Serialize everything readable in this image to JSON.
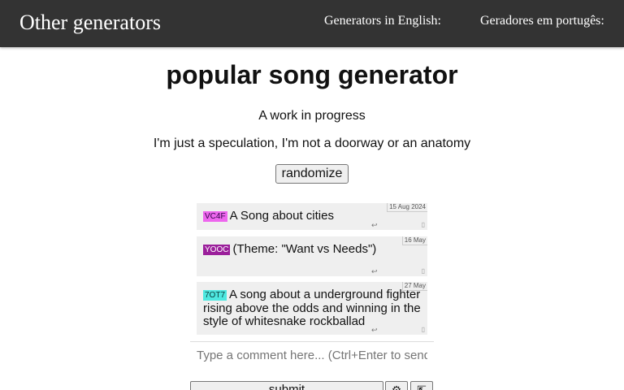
{
  "header": {
    "brand": "Other generators",
    "nav": [
      {
        "label": "Generators in English:"
      },
      {
        "label": "Geradores em portugês:"
      }
    ]
  },
  "main": {
    "title": "popular song generator",
    "subtitle_1": "A work in progress",
    "subtitle_2": "I'm just a speculation, I'm not a doorway or an anatomy",
    "randomize_label": "randomize"
  },
  "comments": [
    {
      "tag": "VC4F",
      "text": "A Song about cities",
      "date": "15 Aug 2024",
      "tag_color": "#ee66ee"
    },
    {
      "tag": "YOOC",
      "text": "(Theme: \"Want vs Needs\")",
      "date": "16 May",
      "tag_color": "#9b1f9b"
    },
    {
      "tag": "7OT7",
      "text": "A song about a underground fighter rising above the odds and winning in the style of whitesnake rockballad",
      "date": "27 May",
      "tag_color": "#4ee8e0"
    }
  ],
  "comment_icons": {
    "reply": "↩",
    "more": "▯"
  },
  "comment_form": {
    "placeholder": "Type a comment here... (Ctrl+Enter to send)",
    "submit_label": "submit",
    "settings_icon": "⚙",
    "avatar_icon": "⇱"
  }
}
